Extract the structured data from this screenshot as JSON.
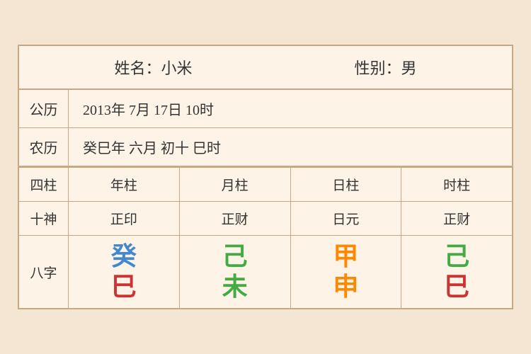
{
  "header": {
    "name_label": "姓名：小米",
    "gender_label": "性别：男"
  },
  "gregorian": {
    "label": "公历",
    "value": "2013年 7月 17日 10时"
  },
  "lunar": {
    "label": "农历",
    "value": "癸巳年 六月 初十 巳时"
  },
  "columns": {
    "label": "四柱",
    "year": "年柱",
    "month": "月柱",
    "day": "日柱",
    "hour": "时柱"
  },
  "shishen": {
    "label": "十神",
    "year": "正印",
    "month": "正财",
    "day": "日元",
    "hour": "正财"
  },
  "bazhi": {
    "label": "八字",
    "year_top": {
      "char": "癸",
      "color": "#4488cc"
    },
    "year_bot": {
      "char": "巳",
      "color": "#cc3333"
    },
    "month_top": {
      "char": "己",
      "color": "#44aa44"
    },
    "month_bot": {
      "char": "未",
      "color": "#44aa44"
    },
    "day_top": {
      "char": "甲",
      "color": "#ff8800"
    },
    "day_bot": {
      "char": "申",
      "color": "#ff8800"
    },
    "hour_top": {
      "char": "己",
      "color": "#44aa44"
    },
    "hour_bot": {
      "char": "巳",
      "color": "#cc3333"
    }
  }
}
